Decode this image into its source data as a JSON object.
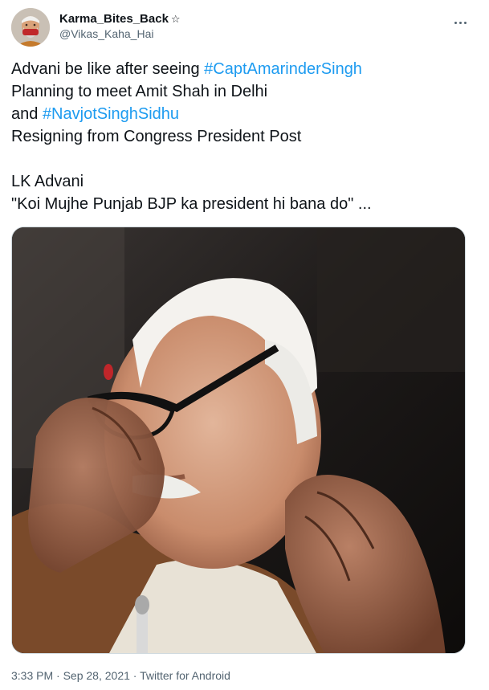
{
  "author": {
    "display_name": "Karma_Bites_Back",
    "badge": "☆",
    "handle": "@Vikas_Kaha_Hai"
  },
  "more_icon": "more-horizontal-icon",
  "text": {
    "line1_prefix": "Advani be like after seeing ",
    "hashtag1": "#CaptAmarinderSingh",
    "line2": "Planning to meet Amit Shah in Delhi",
    "line3_prefix": "and ",
    "hashtag2": "#NavjotSinghSidhu",
    "line4": "Resigning from Congress President Post",
    "line6": "LK Advani",
    "line7": "\"Koi Mujhe Punjab BJP ka president hi bana do\" ..."
  },
  "meta": {
    "time": "3:33 PM",
    "sep1": " · ",
    "date": "Sep 28, 2021",
    "sep2": " · ",
    "source": "Twitter for Android"
  },
  "colors": {
    "link": "#1d9bf0",
    "secondary": "#536471",
    "text": "#0f1419"
  }
}
